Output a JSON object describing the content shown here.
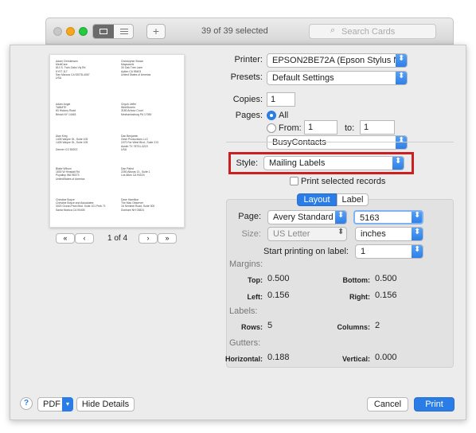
{
  "toolbar": {
    "selection_count": "39 of 39 selected",
    "search_placeholder": "Search Cards",
    "add_label": "+"
  },
  "preview": {
    "labels": [
      {
        "text": "Adam Christensen\nMediCare\n810 S. Twin Oaks Vly Rd\nKY07 117\nSan Marcos CA 92078-4067\nUSA"
      },
      {
        "text": "Christopher Brown\nMaysworld\n30 Oak Tree Lane\nAylton CA 95403\nUnited States of America"
      },
      {
        "text": "Adam Angel\nTABMTE\n83 Hickory Road\nBristol NY 14463"
      },
      {
        "text": "Chyoh Jeffer\nWebStoreIn\n3180 Arbour Court\nMechanicsburg PA 17050"
      },
      {
        "text": "Alan King\n1405 Wayne St., Suite 105\n1405 Wayne St., Suite 105\n\nDenver CO 80202"
      },
      {
        "text": "Dan Benjamin\nGesh Productions LLC\n2470 Far West Blvd., Suite 213\nAustin TX 78731-3219\nUSA"
      },
      {
        "text": "Blake Wilson\n1830 W Hinsdall Rd\nPuyallup WA 98373\nUnitedStates of America"
      },
      {
        "text": "Dan Pabst\n2250 Alturas Ct., Suite 1\nLos Altos CA 94024"
      },
      {
        "text": "Christine Boyce\nChristine Boyce and Associates\n3020 Ocean Park Blvd. Suite 101 Pmb 71\nSanta Monica CA 90405"
      },
      {
        "text": "Dave Hamilton\nThe Mac Observer\n16 Sentinel Road, Suite 300\nDunham NH 03824"
      }
    ],
    "page_indicator": "1 of 4",
    "first_label": "«",
    "prev_label": "‹",
    "next_label": "›",
    "last_label": "»"
  },
  "form": {
    "printer_label": "Printer:",
    "printer_value": "EPSON2BE72A (Epson Stylus N...",
    "presets_label": "Presets:",
    "presets_value": "Default Settings",
    "copies_label": "Copies:",
    "copies_value": "1",
    "pages_label": "Pages:",
    "pages_all": "All",
    "pages_from": "From:",
    "pages_from_value": "1",
    "pages_to": "to:",
    "pages_to_value": "1",
    "app_value": "BusyContacts",
    "style_label": "Style:",
    "style_value": "Mailing Labels",
    "print_selected": "Print selected records",
    "tab_layout": "Layout",
    "tab_label": "Label",
    "page_label": "Page:",
    "page_value": "Avery Standard",
    "page_number": "5163",
    "size_label": "Size:",
    "size_value": "US Letter",
    "units_value": "inches",
    "start_label": "Start printing on label:",
    "start_value": "1",
    "margins_heading": "Margins:",
    "top_label": "Top:",
    "top_value": "0.500",
    "bottom_label": "Bottom:",
    "bottom_value": "0.500",
    "left_label": "Left:",
    "left_value": "0.156",
    "right_label": "Right:",
    "right_value": "0.156",
    "labels_heading": "Labels:",
    "rows_label": "Rows:",
    "rows_value": "5",
    "columns_label": "Columns:",
    "columns_value": "2",
    "gutters_heading": "Gutters:",
    "horizontal_label": "Horizontal:",
    "horizontal_value": "0.188",
    "vertical_label": "Vertical:",
    "vertical_value": "0.000"
  },
  "footer": {
    "help_label": "?",
    "pdf_label": "PDF",
    "hide_details_label": "Hide Details",
    "cancel_label": "Cancel",
    "print_label": "Print"
  },
  "colors": {
    "accent": "#2a7de7",
    "highlight_box": "#cc1f1f"
  }
}
